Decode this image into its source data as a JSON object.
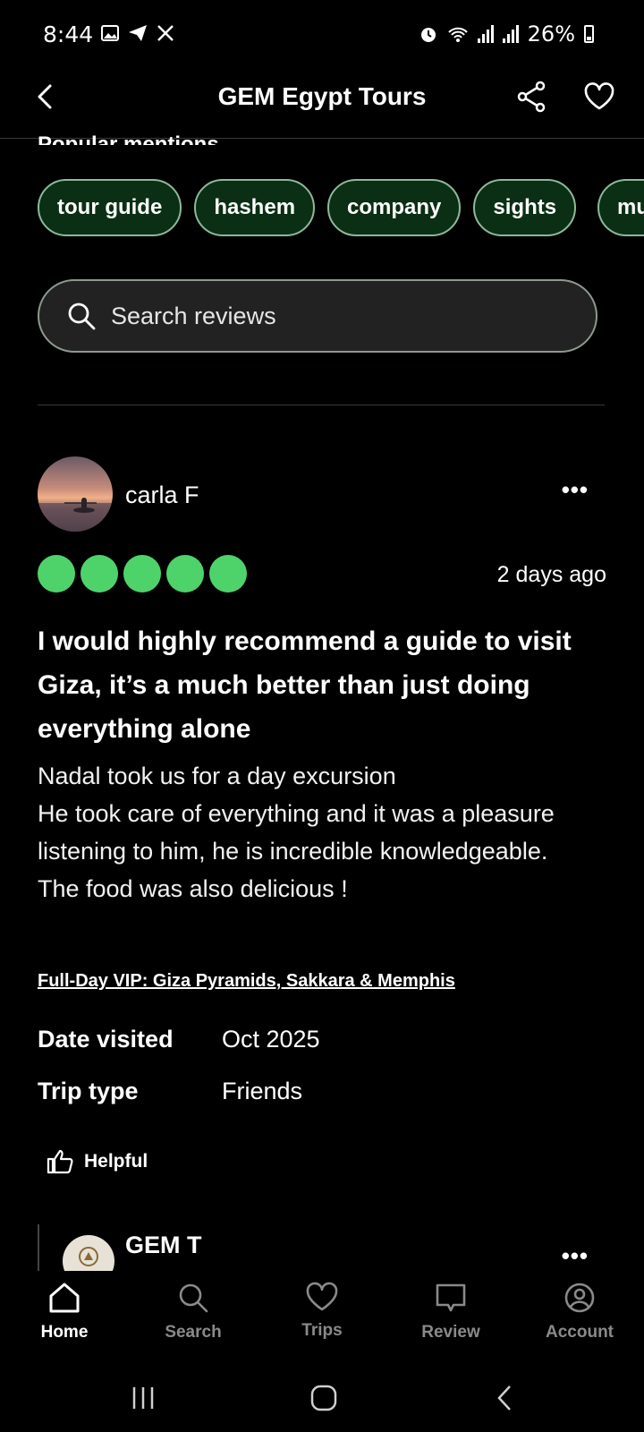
{
  "status_bar": {
    "time": "8:44",
    "battery": "26%",
    "left_icons": [
      "gallery-icon",
      "send-icon",
      "x-logo-icon"
    ],
    "right_icons": [
      "alarm-icon",
      "wifi-icon",
      "signal-icon",
      "signal-icon",
      "battery-icon"
    ]
  },
  "header": {
    "title": "GEM Egypt Tours"
  },
  "popular_mentions": {
    "label": "Popular mentions",
    "chips": [
      "tour guide",
      "hashem",
      "company",
      "sights",
      "mu"
    ]
  },
  "search": {
    "placeholder": "Search reviews"
  },
  "review": {
    "reviewer": "carla F",
    "rating": 5,
    "date": "2 days ago",
    "title": "I would highly recommend a guide to visit Giza, it’s a much better than just doing everything alone",
    "body": "Nadal took us for a day excursion\nHe took care of everything and it was a pleasure listening to him, he is incredible knowledgeable.\nThe food was also delicious !",
    "tour_link": "Full-Day VIP: Giza Pyramids, Sakkara & Memphis",
    "date_visited_label": "Date visited",
    "date_visited": "Oct 2025",
    "trip_type_label": "Trip type",
    "trip_type": "Friends",
    "helpful_label": "Helpful"
  },
  "reply": {
    "name": "GEM T"
  },
  "bottom_nav": {
    "items": [
      {
        "label": "Home",
        "icon": "home-icon",
        "active": true
      },
      {
        "label": "Search",
        "icon": "search-icon",
        "active": false
      },
      {
        "label": "Trips",
        "icon": "heart-icon",
        "active": false
      },
      {
        "label": "Review",
        "icon": "review-icon",
        "active": false
      },
      {
        "label": "Account",
        "icon": "account-icon",
        "active": false
      }
    ]
  },
  "colors": {
    "rating_dot": "#4ed36b",
    "chip_bg": "#0a2f14",
    "chip_border": "#8fb89a"
  }
}
